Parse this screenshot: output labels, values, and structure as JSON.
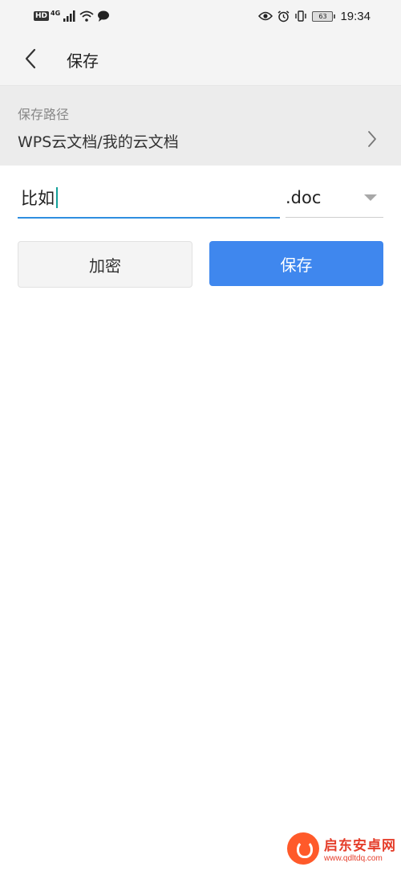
{
  "status_bar": {
    "hd": "HD",
    "network": "4G",
    "battery_level": "63",
    "time": "19:34",
    "icons": [
      "signal-icon",
      "wifi-icon",
      "message-icon",
      "eye-icon",
      "alarm-icon",
      "vibrate-icon",
      "battery-icon"
    ]
  },
  "app_bar": {
    "title": "保存",
    "back_icon": "chevron-left-icon"
  },
  "save_path": {
    "label": "保存路径",
    "value": "WPS云文档/我的云文档",
    "chevron_icon": "chevron-right-icon"
  },
  "filename": {
    "value": "比如",
    "accent_color": "#2f8ee0"
  },
  "extension": {
    "selected": ".doc"
  },
  "actions": {
    "encrypt_label": "加密",
    "save_label": "保存",
    "save_color": "#3f87ee"
  },
  "watermark": {
    "name": "启东安卓网",
    "url": "www.qdltdq.com"
  }
}
